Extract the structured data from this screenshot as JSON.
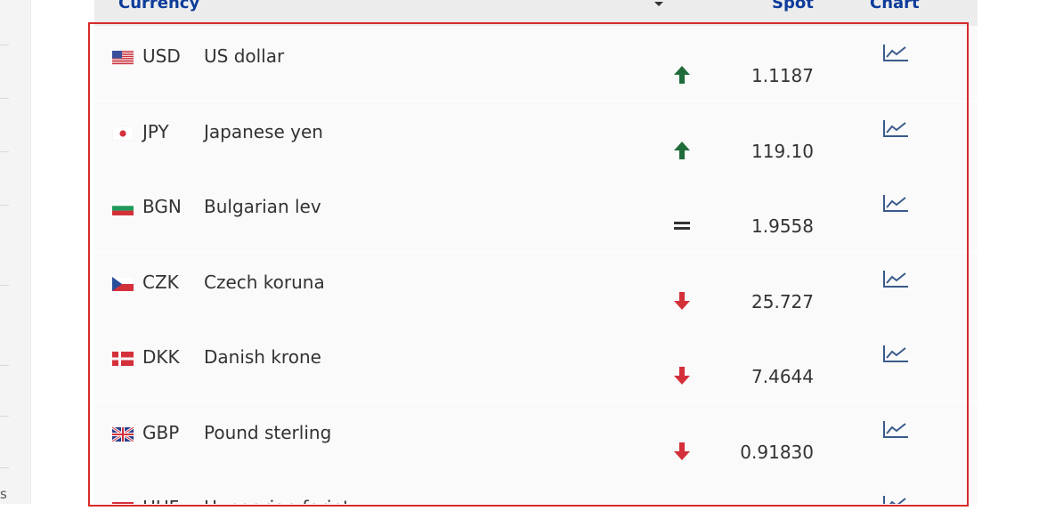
{
  "header": {
    "currency": "Currency",
    "spot": "Spot",
    "chart": "Chart"
  },
  "sidebar_fragment": "s",
  "colors": {
    "header_text": "#0d3c9a",
    "up_arrow": "#1f6b3a",
    "down_arrow": "#d3303a",
    "highlight_border": "#d62b2b"
  },
  "rows": [
    {
      "flag": "us-flag-icon",
      "code": "USD",
      "name": "US dollar",
      "trend": "up",
      "spot": "1.1187"
    },
    {
      "flag": "japan-flag-icon",
      "code": "JPY",
      "name": "Japanese yen",
      "trend": "up",
      "spot": "119.10"
    },
    {
      "flag": "bulgaria-flag-icon",
      "code": "BGN",
      "name": "Bulgarian lev",
      "trend": "equal",
      "spot": "1.9558"
    },
    {
      "flag": "czech-flag-icon",
      "code": "CZK",
      "name": "Czech koruna",
      "trend": "down",
      "spot": "25.727"
    },
    {
      "flag": "denmark-flag-icon",
      "code": "DKK",
      "name": "Danish krone",
      "trend": "down",
      "spot": "7.4644"
    },
    {
      "flag": "uk-flag-icon",
      "code": "GBP",
      "name": "Pound sterling",
      "trend": "down",
      "spot": "0.91830"
    },
    {
      "flag": "hungary-flag-icon",
      "code": "HUF",
      "name": "Hungarian forint",
      "trend": "",
      "spot": ""
    }
  ]
}
